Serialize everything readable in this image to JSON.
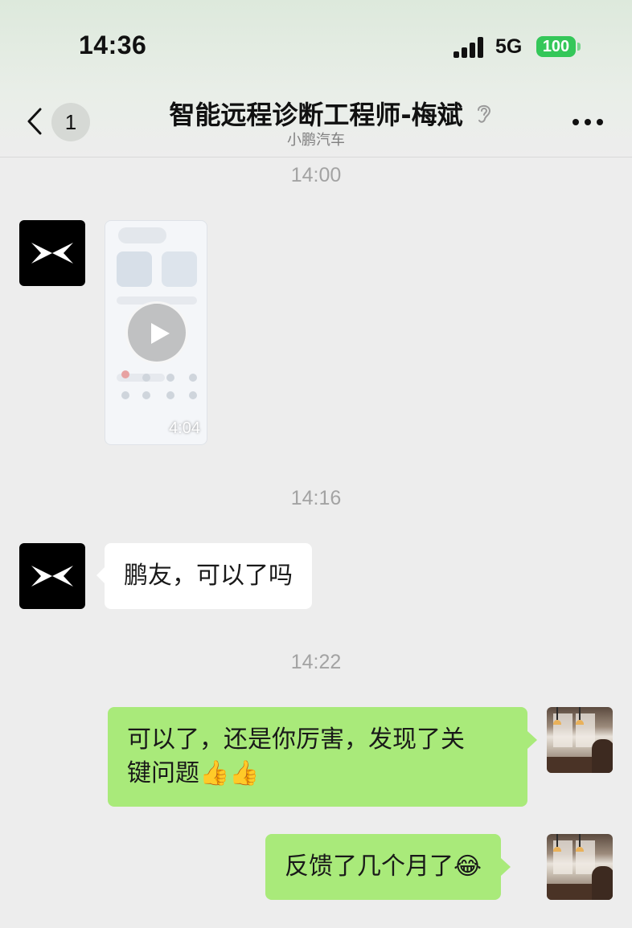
{
  "status_bar": {
    "time": "14:36",
    "network": "5G",
    "battery": "100",
    "battery_color": "#34c759"
  },
  "header": {
    "unread_count": "1",
    "title": "智能远程诊断工程师-梅斌",
    "subtitle": "小鹏汽车",
    "icons": [
      "back-chevron-icon",
      "ear-icon",
      "more-icon"
    ]
  },
  "messages": [
    {
      "timestamp": "14:00"
    },
    {
      "sender": "other",
      "type": "video",
      "duration": "4:04"
    },
    {
      "timestamp": "14:16"
    },
    {
      "sender": "other",
      "type": "text",
      "text": "鹏友，可以了吗"
    },
    {
      "timestamp": "14:22"
    },
    {
      "sender": "me",
      "type": "text",
      "line1": "可以了，还是你厉害，发现了关",
      "line2": "键问题",
      "emoji": "👍👍"
    },
    {
      "sender": "me",
      "type": "text",
      "text": "反馈了几个月了",
      "emoji": "😂"
    }
  ],
  "colors": {
    "background": "#ededed",
    "my_bubble": "#a9ea7a",
    "other_bubble": "#ffffff",
    "timestamp": "#a3a3a3"
  }
}
